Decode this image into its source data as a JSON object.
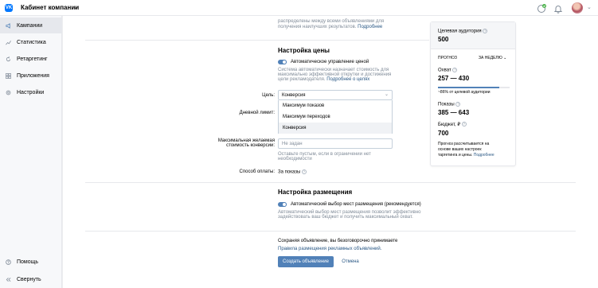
{
  "header": {
    "logo_text": "VK",
    "title": "Кабинет компании",
    "icons": [
      "chevron-down-icon",
      "support-icon",
      "bell-icon",
      "avatar"
    ]
  },
  "sidebar": {
    "items": [
      {
        "label": "Кампании",
        "icon": "megaphone-icon",
        "active": true
      },
      {
        "label": "Статистика",
        "icon": "chart-icon"
      },
      {
        "label": "Ретаргетинг",
        "icon": "retarget-icon"
      },
      {
        "label": "Приложения",
        "icon": "apps-grid-icon"
      },
      {
        "label": "Настройки",
        "icon": "gear-icon"
      }
    ],
    "bottom_items": [
      {
        "label": "Помощь",
        "icon": "help-icon"
      },
      {
        "label": "Свернуть",
        "icon": "collapse-icon"
      }
    ]
  },
  "top_text": {
    "line1": "распределены между всеми объявлениями для",
    "line2_text": "получения наилучших результатов.",
    "line2_link": "Подробнее"
  },
  "price": {
    "title": "Настройка цены",
    "auto_toggle_label": "Автоматическое управление ценой",
    "description_line1": "Система автоматически назначает стоимость для",
    "description_line2": "максимально эффективной открутки и достижения",
    "description_line3_text": "цели рекламодателя.",
    "description_link": "Подробнее о целях",
    "goal_label": "Цель:",
    "goal_value": "Конверсия",
    "goal_options": [
      "Максимум показов",
      "Максимум переходов",
      "Конверсия"
    ],
    "daily_limit_label": "Дневной лимит:",
    "max_cost_label_line1": "Максимальная желаемая",
    "max_cost_label_line2": "стоимость конверсии:",
    "max_cost_placeholder": "Не задан",
    "max_cost_hint_line1": "Оставьте пустым, если в ограничении нет",
    "max_cost_hint_line2": "необходимости",
    "payment_label": "Способ оплаты:",
    "payment_value": "За показы"
  },
  "placement": {
    "title": "Настройка размещения",
    "auto_toggle_label": "Автоматический выбор мест размещения (рекомендуется)",
    "description_line1": "Автоматический выбор мест размещения позволит эффективно",
    "description_line2": "задействовать ваш бюджет и получить максимальный охват."
  },
  "footer": {
    "agreement_text": "Сохраняя объявление, вы безоговорочно принимаете",
    "agreement_link": "Правила размещения рекламных объявлений.",
    "create_button": "Создать объявление",
    "cancel_button": "Отмена"
  },
  "forecast": {
    "audience_label": "Целевая аудитория",
    "audience_value": "500",
    "forecast_label": "ПРОГНОЗ",
    "period_label": "ЗА НЕДЕЛЮ",
    "reach_label": "Охват",
    "reach_value": "257 — 430",
    "reach_share_percent": 86,
    "reach_note": "~86% от целевой аудитории",
    "impressions_label": "Показы",
    "impressions_value": "385 — 643",
    "budget_label": "Бюджет, ₽",
    "budget_value": "700",
    "note_line1": "Прогноз рассчитывается на",
    "note_line2": "основе ваших настроек",
    "note_line3_text": "таргетинга и цены.",
    "note_link": "Подробнее"
  },
  "colors": {
    "accent": "#5181b8",
    "link": "#2a5885",
    "muted": "#818c99",
    "background": "#edeef0"
  }
}
